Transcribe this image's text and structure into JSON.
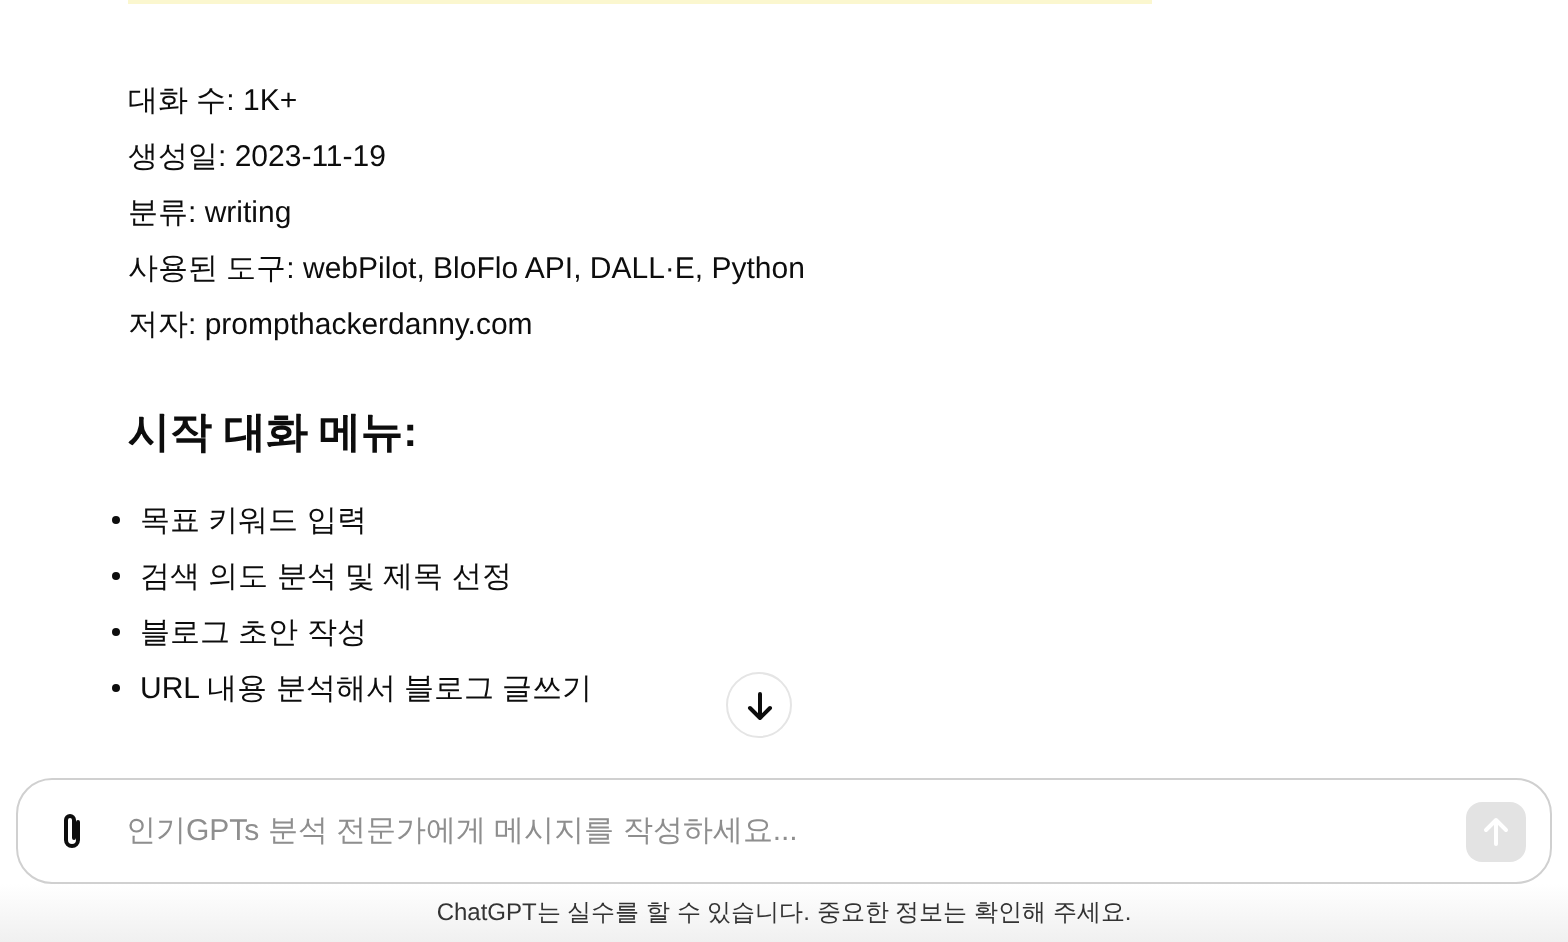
{
  "info_lines": [
    "대화 수: 1K+",
    "생성일: 2023-11-19",
    "분류: writing",
    "사용된 도구: webPilot, BloFlo API, DALL·E, Python",
    "저자: prompthackerdanny.com"
  ],
  "heading": "시작 대화 메뉴:",
  "menu_items": [
    "목표 키워드 입력",
    "검색 의도 분석 및 제목 선정",
    "블로그 초안 작성",
    "URL 내용 분석해서 블로그 글쓰기"
  ],
  "composer": {
    "placeholder": "인기GPTs 분석 전문가에게 메시지를 작성하세요...",
    "send_disabled": true
  },
  "footer": "ChatGPT는 실수를 할 수 있습니다. 중요한 정보는 확인해 주세요."
}
